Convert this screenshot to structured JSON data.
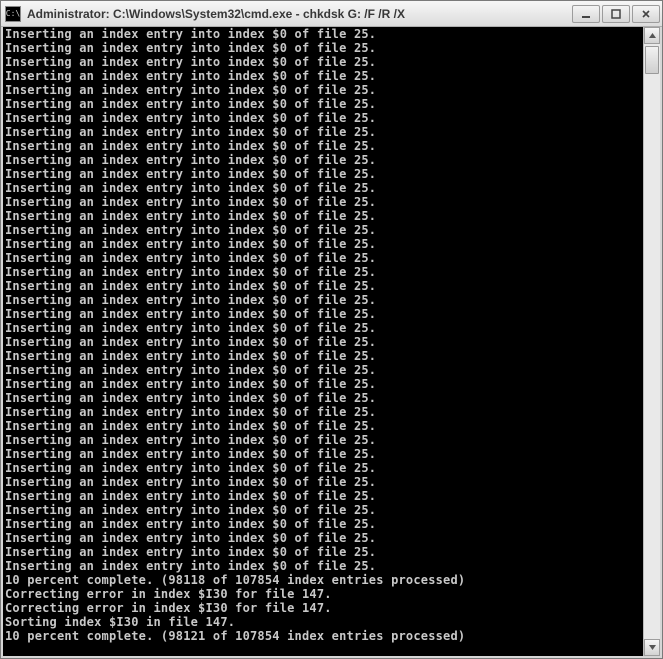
{
  "window": {
    "title": "Administrator: C:\\Windows\\System32\\cmd.exe - chkdsk  G: /F /R /X",
    "icon_label": "C:\\"
  },
  "console": {
    "repeated_line": "Inserting an index entry into index $0 of file 25.",
    "repeat_count": 39,
    "tail_lines": [
      "10 percent complete. (98118 of 107854 index entries processed)",
      "Correcting error in index $I30 for file 147.",
      "Correcting error in index $I30 for file 147.",
      "Sorting index $I30 in file 147.",
      "10 percent complete. (98121 of 107854 index entries processed)"
    ]
  }
}
